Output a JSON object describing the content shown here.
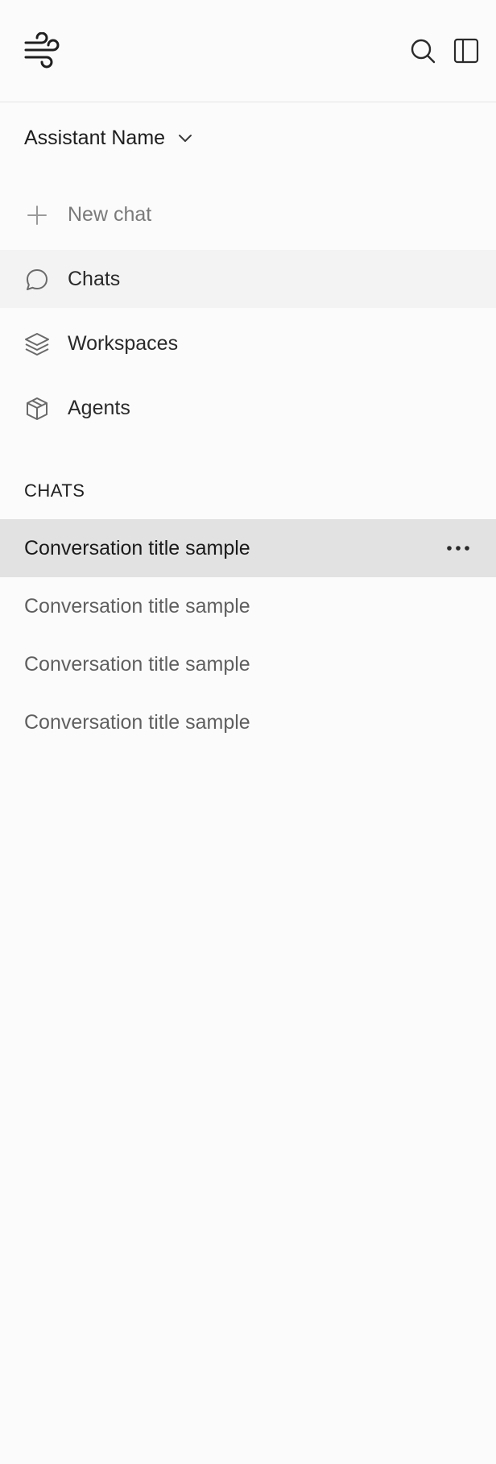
{
  "header": {
    "logo_icon": "wind-icon",
    "search_icon": "search-icon",
    "sidebar_toggle_icon": "sidebar-panel-icon"
  },
  "assistant_selector": {
    "label": "Assistant Name",
    "icon": "chevron-down-icon"
  },
  "nav": {
    "new_chat": {
      "label": "New chat",
      "icon": "plus-icon"
    },
    "items": [
      {
        "label": "Chats",
        "icon": "chat-bubble-icon",
        "active": true
      },
      {
        "label": "Workspaces",
        "icon": "layers-icon",
        "active": false
      },
      {
        "label": "Agents",
        "icon": "box-icon",
        "active": false
      }
    ]
  },
  "chats_section": {
    "heading": "CHATS",
    "items": [
      {
        "title": "Conversation title sample",
        "selected": true,
        "more_icon": "more-horizontal-icon"
      },
      {
        "title": "Conversation title sample",
        "selected": false
      },
      {
        "title": "Conversation title sample",
        "selected": false
      },
      {
        "title": "Conversation title sample",
        "selected": false
      }
    ]
  },
  "colors": {
    "background": "#fbfbfb",
    "active_nav": "#f3f3f3",
    "selected_chat": "#e2e2e2",
    "muted_text": "#5f5f5f"
  }
}
